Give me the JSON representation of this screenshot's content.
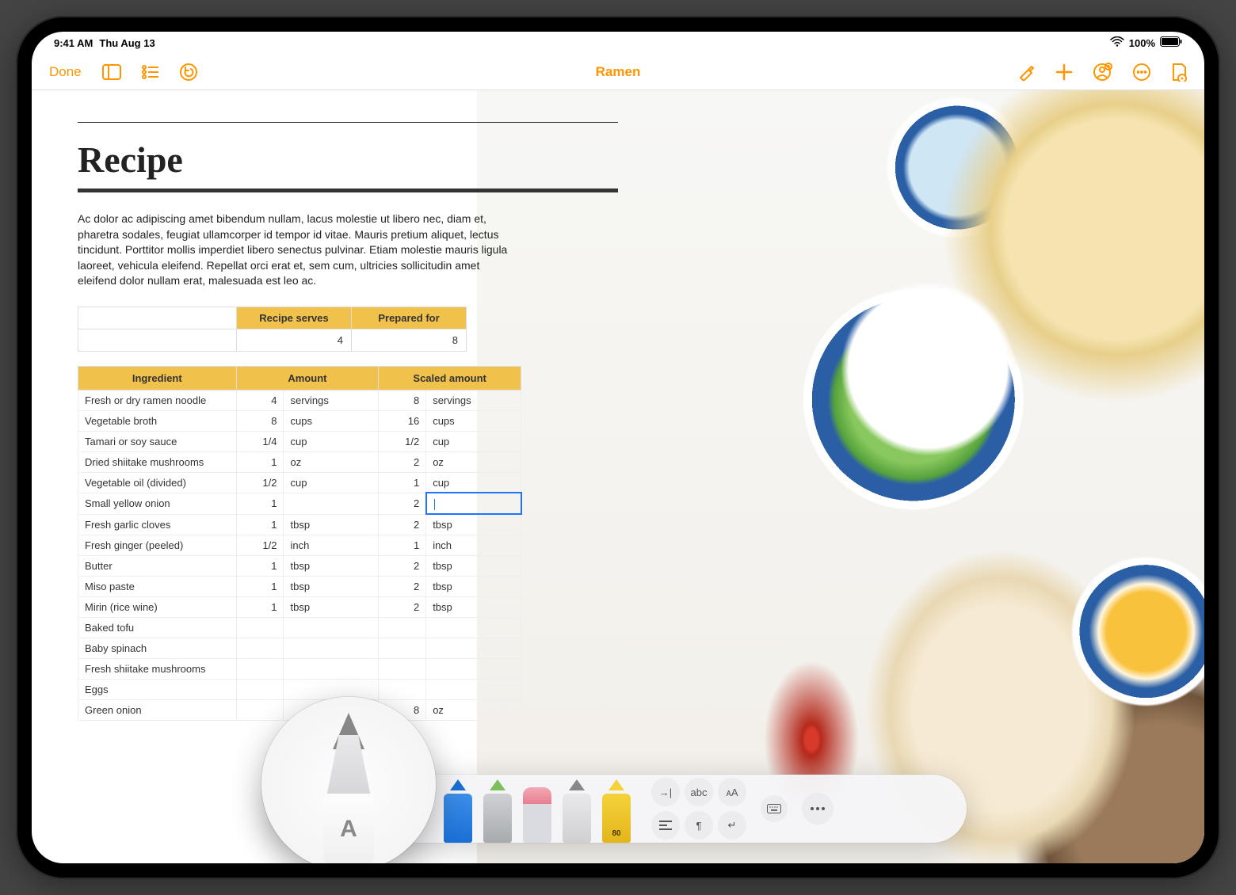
{
  "status": {
    "time": "9:41 AM",
    "date": "Thu Aug 13",
    "battery": "100%"
  },
  "topbar": {
    "done": "Done",
    "title": "Ramen"
  },
  "doc": {
    "heading": "Recipe",
    "paragraph": "Ac dolor ac adipiscing amet bibendum nullam, lacus molestie ut libero nec, diam et, pharetra sodales, feugiat ullamcorper id tempor id vitae. Mauris pretium aliquet, lectus tincidunt. Porttitor mollis imperdiet libero senectus pulvinar. Etiam molestie mauris ligula laoreet, vehicula eleifend. Repellat orci erat et, sem cum, ultricies sollicitudin amet eleifend dolor nullam erat, malesuada est leo ac."
  },
  "serves": {
    "headers": [
      "Recipe serves",
      "Prepared for"
    ],
    "values": [
      "4",
      "8"
    ]
  },
  "ingredients": {
    "headers": [
      "Ingredient",
      "Amount",
      "Scaled amount"
    ],
    "rows": [
      {
        "name": "Fresh or dry ramen noodle",
        "amt": "4",
        "unit": "servings",
        "samt": "8",
        "sunit": "servings"
      },
      {
        "name": "Vegetable broth",
        "amt": "8",
        "unit": "cups",
        "samt": "16",
        "sunit": "cups"
      },
      {
        "name": "Tamari or soy sauce",
        "amt": "1/4",
        "unit": "cup",
        "samt": "1/2",
        "sunit": "cup"
      },
      {
        "name": "Dried shiitake mushrooms",
        "amt": "1",
        "unit": "oz",
        "samt": "2",
        "sunit": "oz"
      },
      {
        "name": "Vegetable oil (divided)",
        "amt": "1/2",
        "unit": "cup",
        "samt": "1",
        "sunit": "cup"
      },
      {
        "name": "Small yellow onion",
        "amt": "1",
        "unit": "",
        "samt": "2",
        "sunit": "",
        "selected": true
      },
      {
        "name": "Fresh garlic cloves",
        "amt": "1",
        "unit": "tbsp",
        "samt": "2",
        "sunit": "tbsp"
      },
      {
        "name": "Fresh ginger (peeled)",
        "amt": "1/2",
        "unit": "inch",
        "samt": "1",
        "sunit": "inch"
      },
      {
        "name": "Butter",
        "amt": "1",
        "unit": "tbsp",
        "samt": "2",
        "sunit": "tbsp"
      },
      {
        "name": "Miso paste",
        "amt": "1",
        "unit": "tbsp",
        "samt": "2",
        "sunit": "tbsp"
      },
      {
        "name": "Mirin (rice wine)",
        "amt": "1",
        "unit": "tbsp",
        "samt": "2",
        "sunit": "tbsp"
      },
      {
        "name": "Baked tofu",
        "amt": "",
        "unit": "",
        "samt": "",
        "sunit": ""
      },
      {
        "name": "Baby spinach",
        "amt": "",
        "unit": "",
        "samt": "",
        "sunit": ""
      },
      {
        "name": "Fresh shiitake mushrooms",
        "amt": "",
        "unit": "",
        "samt": "",
        "sunit": ""
      },
      {
        "name": "Eggs",
        "amt": "",
        "unit": "",
        "samt": "",
        "sunit": ""
      },
      {
        "name": "Green onion",
        "amt": "",
        "unit": "",
        "samt": "8",
        "sunit": "oz"
      }
    ]
  },
  "toolbar": {
    "magnify_label": "A",
    "highlighter_label": "80",
    "gridLabels": {
      "abc": "abc",
      "aa": "ᴀA"
    },
    "gridIcons": [
      "indent-icon",
      "abc",
      "font-size",
      "keyboard-icon",
      "align-icon",
      "pilcrow-icon",
      "return-icon"
    ]
  }
}
